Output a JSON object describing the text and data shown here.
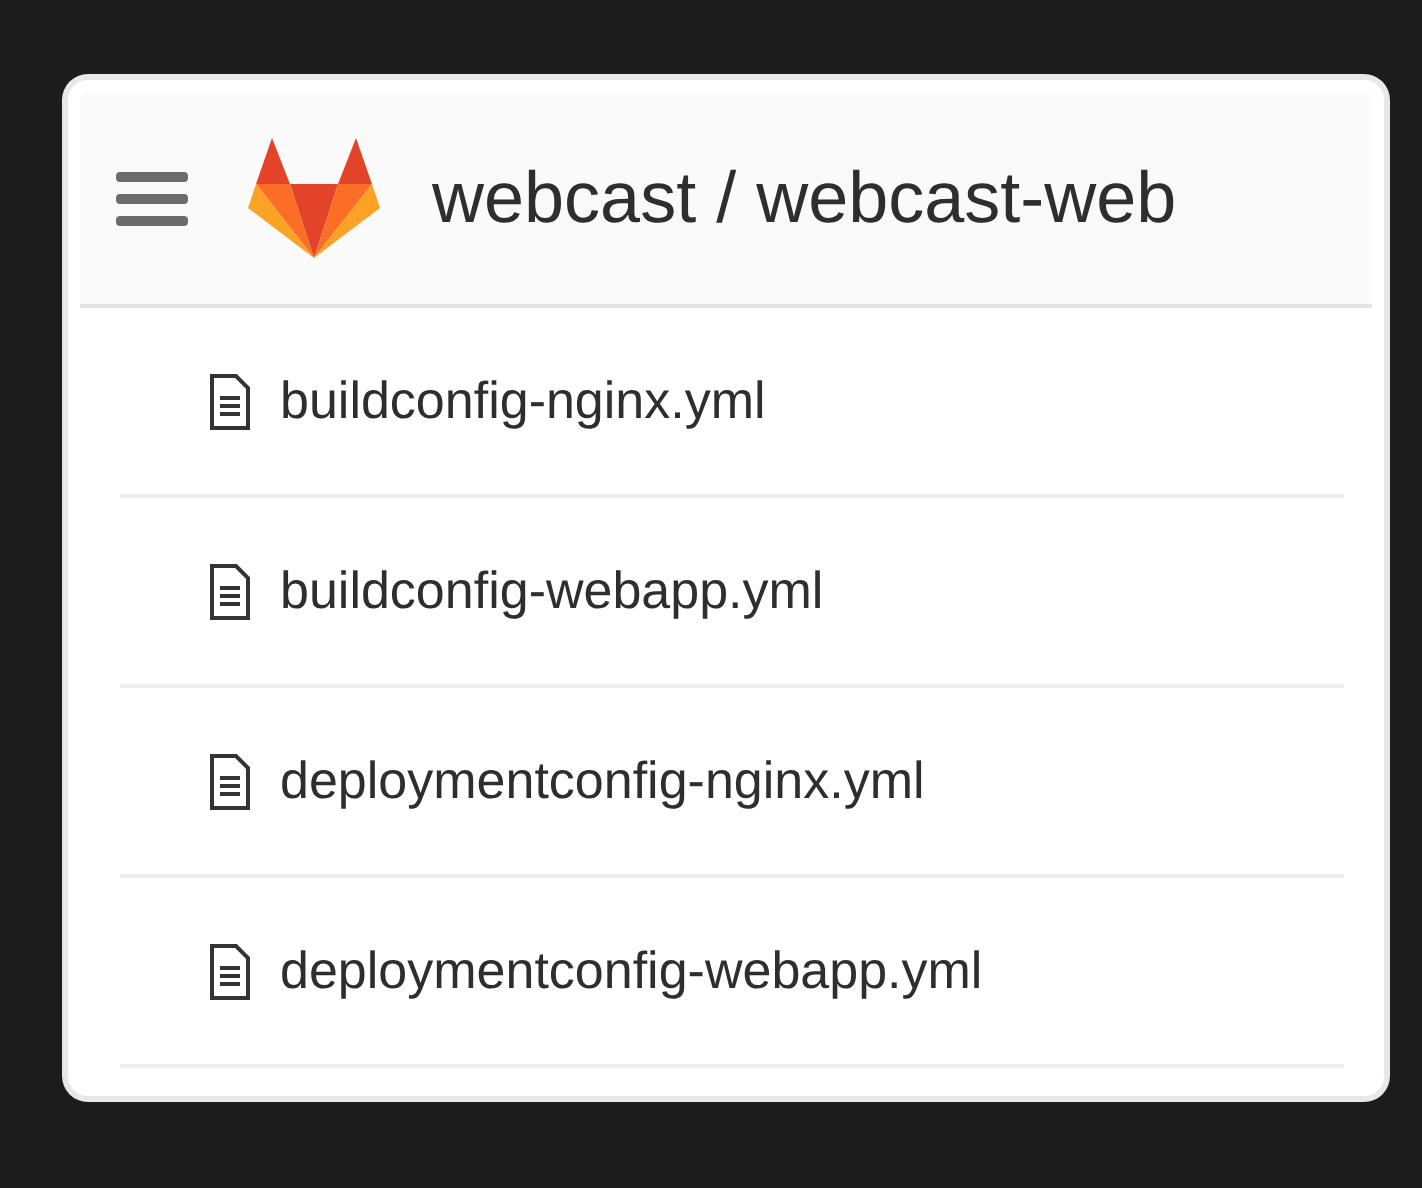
{
  "header": {
    "title": "webcast / webcast-web"
  },
  "files": [
    {
      "name": "buildconfig-nginx.yml"
    },
    {
      "name": "buildconfig-webapp.yml"
    },
    {
      "name": "deploymentconfig-nginx.yml"
    },
    {
      "name": "deploymentconfig-webapp.yml"
    }
  ]
}
